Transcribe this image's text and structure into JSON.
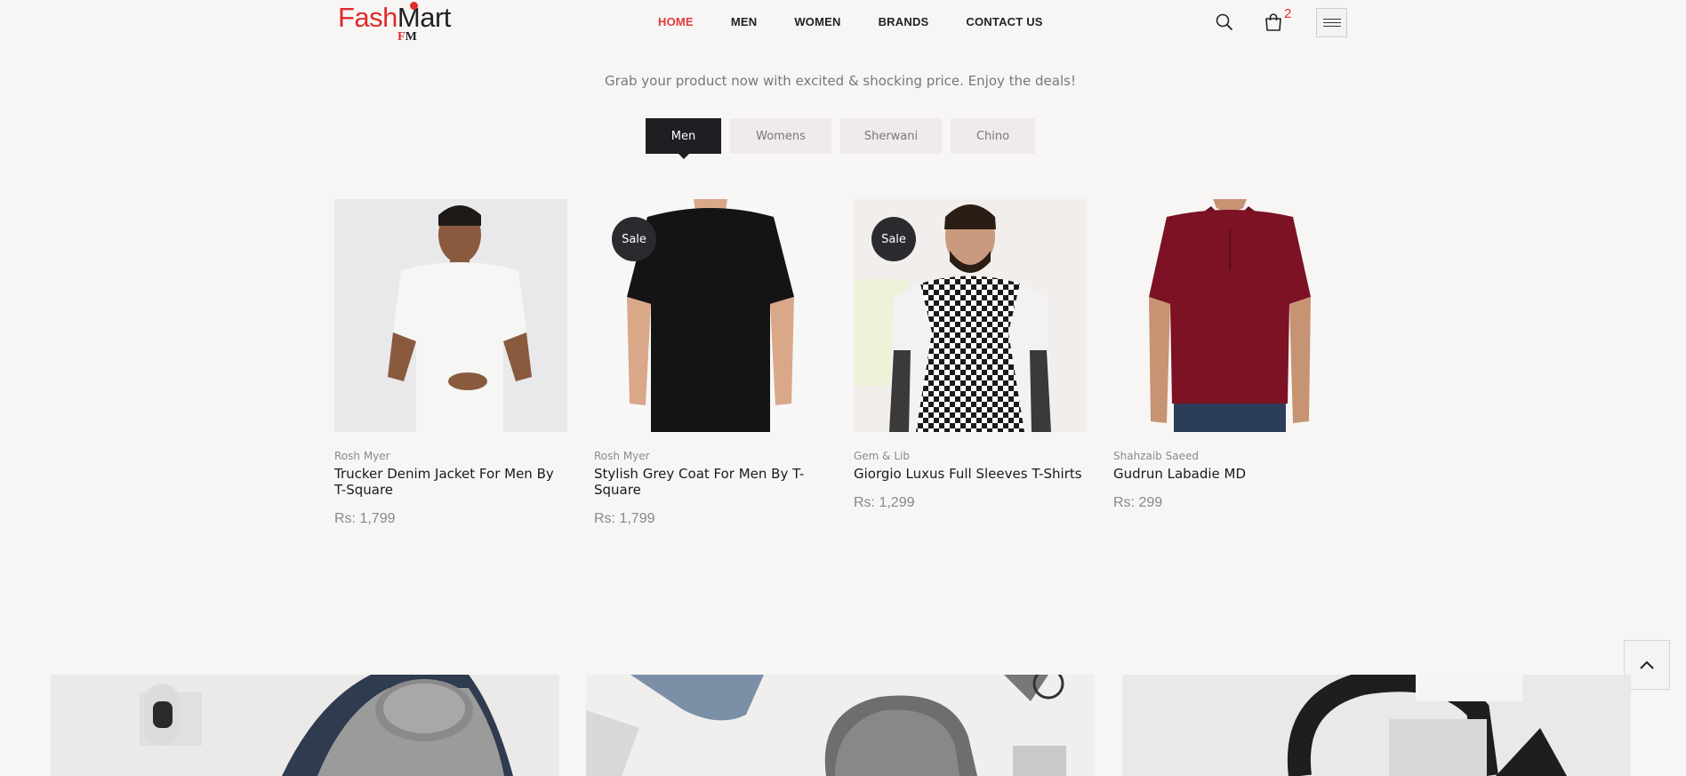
{
  "header": {
    "logo": {
      "red_part": "Fash",
      "dark_part": "Mart",
      "sub_red": "F",
      "sub_dark": "M"
    },
    "nav": [
      {
        "label": "HOME",
        "active": true
      },
      {
        "label": "MEN",
        "active": false
      },
      {
        "label": "WOMEN",
        "active": false
      },
      {
        "label": "BRANDS",
        "active": false
      },
      {
        "label": "CONTACT US",
        "active": false
      }
    ],
    "cart_count": "2",
    "icons": [
      "search-icon",
      "cart-icon",
      "hamburger-menu-icon"
    ]
  },
  "tagline": "Grab your product now with excited & shocking price. Enjoy the deals!",
  "tabs": [
    {
      "label": "Men",
      "active": true
    },
    {
      "label": "Womens",
      "active": false
    },
    {
      "label": "Sherwani",
      "active": false
    },
    {
      "label": "Chino",
      "active": false
    }
  ],
  "products": [
    {
      "brand": "Rosh Myer",
      "title": "Trucker Denim Jacket For Men By T-Square",
      "price": "Rs: 1,799",
      "sale": false,
      "shirt_color": "#f2f2f0"
    },
    {
      "brand": "Rosh Myer",
      "title": "Stylish Grey Coat For Men By T-Square",
      "price": "Rs: 1,799",
      "sale": true,
      "sale_label": "Sale",
      "shirt_color": "#141414"
    },
    {
      "brand": "Gem & Lib",
      "title": "Giorgio Luxus Full Sleeves T-Shirts",
      "price": "Rs: 1,299",
      "sale": true,
      "sale_label": "Sale",
      "shirt_color": "#ffffff"
    },
    {
      "brand": "Shahzaib Saeed",
      "title": "Gudrun Labadie MD",
      "price": "Rs: 299",
      "sale": false,
      "shirt_color": "#7c1223"
    }
  ],
  "colors": {
    "accent": "#e02b2b",
    "dark": "#1f1e23",
    "background": "#f8f6f5"
  }
}
